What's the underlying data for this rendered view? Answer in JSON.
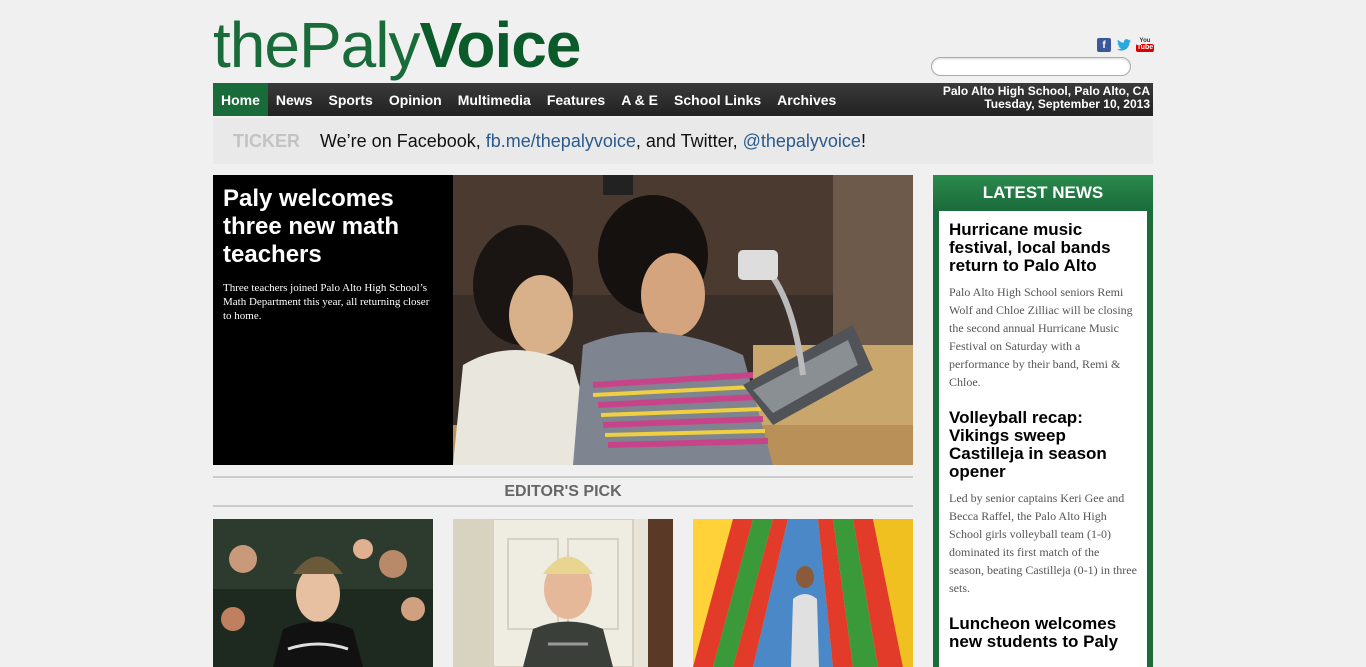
{
  "header": {
    "logo_part1": "thePaly",
    "logo_part2": "Voice",
    "location": "Palo Alto High School, Palo Alto, CA",
    "date": "Tuesday, September 10, 2013"
  },
  "social": {
    "facebook_glyph": "f",
    "twitter_glyph": "🐦",
    "youtube_top": "You",
    "youtube_bottom": "Tube"
  },
  "search": {
    "value": "",
    "placeholder": ""
  },
  "nav": {
    "items": [
      {
        "label": "Home",
        "active": true
      },
      {
        "label": "News"
      },
      {
        "label": "Sports"
      },
      {
        "label": "Opinion"
      },
      {
        "label": "Multimedia"
      },
      {
        "label": "Features"
      },
      {
        "label": "A & E"
      },
      {
        "label": "School Links"
      },
      {
        "label": "Archives"
      }
    ]
  },
  "ticker": {
    "label": "TICKER",
    "text_before": "We’re on Facebook, ",
    "link1": "fb.me/thepalyvoice",
    "text_middle": ", and Twitter, ",
    "link2": "@thepalyvoice",
    "text_after": "!"
  },
  "feature": {
    "title": "Paly welcomes three new math teachers",
    "summary": "Three teachers joined Palo Alto High School’s Math Department this year, all returning closer to home."
  },
  "editors_pick": {
    "title": "EDITOR'S PICK"
  },
  "latest_news": {
    "title": "LATEST NEWS",
    "stories": [
      {
        "title": "Hurricane music festival, local bands return to Palo Alto",
        "summary": "Palo Alto High School seniors Remi Wolf and Chloe Zilliac will be closing the second annual Hurricane Music Festival on Saturday with a performance by their band, Remi & Chloe."
      },
      {
        "title": "Volleyball recap: Vikings sweep Castilleja in season opener",
        "summary": "Led by senior captains Keri Gee and Becca Raffel, the Palo Alto High School girls volleyball team (1-0) dominated its first match of the season, beating Castilleja (0-1) in three sets."
      },
      {
        "title": "Luncheon welcomes new students to Paly",
        "summary": ""
      }
    ]
  },
  "colors": {
    "brand_green": "#1a6b3a",
    "nav_dark": "#2a2a2a",
    "link_blue": "#2a5b8c"
  }
}
